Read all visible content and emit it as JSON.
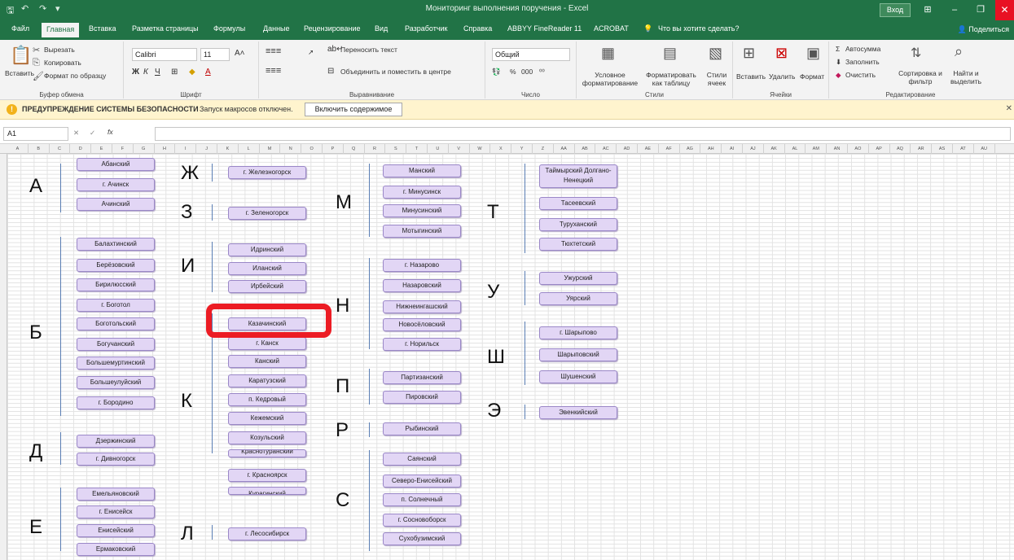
{
  "window": {
    "title": "Мониторинг выполнения поручения - Excel",
    "signin": "Вход",
    "close_glyph": "✕"
  },
  "tabs": [
    "Файл",
    "Главная",
    "Вставка",
    "Разметка страницы",
    "Формулы",
    "Данные",
    "Рецензирование",
    "Вид",
    "Разработчик",
    "Справка",
    "ABBYY FineReader 11",
    "ACROBAT",
    "Что вы хотите сделать?"
  ],
  "share": "Поделиться",
  "ribbon": {
    "clipboard": {
      "paste": "Вставить",
      "cut": "Вырезать",
      "copy": "Копировать",
      "format_painter": "Формат по образцу",
      "label": "Буфер обмена"
    },
    "font": {
      "name": "Calibri",
      "size": "11",
      "label": "Шрифт"
    },
    "alignment": {
      "wrap": "Переносить текст",
      "merge": "Объединить и поместить в центре",
      "label": "Выравнивание"
    },
    "number": {
      "format": "Общий",
      "percent": "%",
      "thousands": "000",
      "label": "Число"
    },
    "styles": {
      "conditional": "Условное форматирование",
      "as_table": "Форматировать как таблицу",
      "cell_styles": "Стили ячеек",
      "label": "Стили"
    },
    "cells": {
      "insert": "Вставить",
      "delete": "Удалить",
      "format": "Формат",
      "label": "Ячейки"
    },
    "editing": {
      "autosum": "Автосумма",
      "fill": "Заполнить",
      "clear": "Очистить",
      "sort": "Сортировка и фильтр",
      "find": "Найти и выделить",
      "label": "Редактирование"
    }
  },
  "security": {
    "title": "ПРЕДУПРЕЖДЕНИЕ СИСТЕМЫ БЕЗОПАСНОСТИ",
    "message": "Запуск макросов отключен.",
    "button": "Включить содержимое"
  },
  "formula_bar": {
    "name_box": "A1",
    "fx": "fx",
    "value": ""
  },
  "columns": [
    "A",
    "B",
    "C",
    "D",
    "E",
    "F",
    "G",
    "H",
    "I",
    "J",
    "K",
    "L",
    "M",
    "N",
    "O",
    "P",
    "Q",
    "R",
    "S",
    "T",
    "U",
    "V",
    "W",
    "X",
    "Y",
    "Z",
    "AA",
    "AB",
    "AC",
    "AD",
    "AE",
    "AF",
    "AG",
    "AH",
    "AI",
    "AJ",
    "AK",
    "AL",
    "AM",
    "AN",
    "AO",
    "AP",
    "AQ",
    "AR",
    "AS",
    "AT",
    "AU"
  ],
  "sheet": {
    "letters": [
      "А",
      "Б",
      "Д",
      "Е",
      "Ж",
      "З",
      "И",
      "К",
      "Л",
      "М",
      "Н",
      "П",
      "Р",
      "С",
      "Т",
      "У",
      "Ш",
      "Э"
    ],
    "buttons": {
      "A": [
        "Абанский",
        "г. Ачинск",
        "Ачинский"
      ],
      "B": [
        "Балахтинский",
        "Берёзовский",
        "Бирилюсский",
        "г. Боготол",
        "Боготольский",
        "Богучанский",
        "Большемуртинский",
        "Большеулуйский",
        "г. Бородино"
      ],
      "D": [
        "Дзержинский",
        "г. Дивногорск"
      ],
      "E": [
        "Емельяновский",
        "г. Енисейск",
        "Енисейский",
        "Ермаковский"
      ],
      "ZH": [
        "г. Железногорск"
      ],
      "Z": [
        "г. Зеленогорск"
      ],
      "I": [
        "Идринский",
        "Иланский",
        "Ирбейский"
      ],
      "K": [
        "Казачинский",
        "г. Канск",
        "Канский",
        "Каратузский",
        "п. Кедровый",
        "Кежемский",
        "Козульский",
        "Краснотуранский",
        "г. Красноярск",
        "Курагинский"
      ],
      "L": [
        "г. Лесосибирск"
      ],
      "M": [
        "Манский",
        "г. Минусинск",
        "Минусинский",
        "Мотыгинский"
      ],
      "N": [
        "г. Назарово",
        "Назаровский",
        "Нижнеингашский",
        "Новосёловский",
        "г. Норильск"
      ],
      "P": [
        "Партизанский",
        "Пировский"
      ],
      "R": [
        "Рыбинский"
      ],
      "S": [
        "Саянский",
        "Северо-Енисейский",
        "п. Солнечный",
        "г. Сосновоборск",
        "Сухобузимский"
      ],
      "T": [
        "Таймырский Долгано-Ненецкий",
        "Тасеевский",
        "Туруханский",
        "Тюхтетский"
      ],
      "U": [
        "Ужурский",
        "Уярский"
      ],
      "SH": [
        "г. Шарыпово",
        "Шарыповский",
        "Шушенский"
      ],
      "E2": [
        "Эвенкийский"
      ]
    }
  }
}
